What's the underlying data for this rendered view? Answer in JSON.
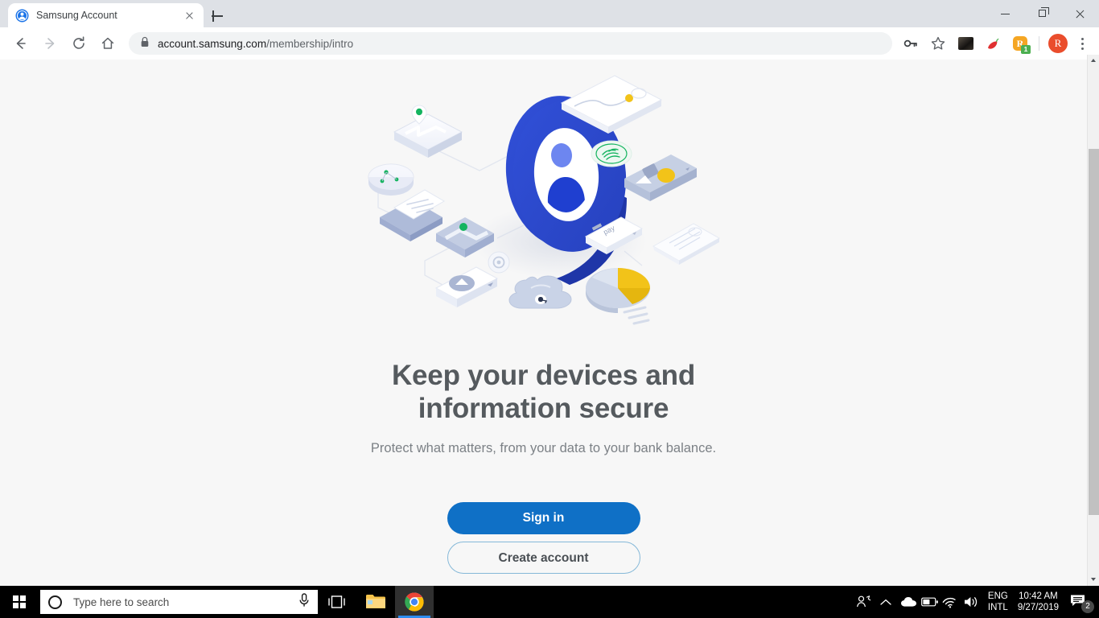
{
  "browser": {
    "tab": {
      "title": "Samsung Account",
      "favicon": "samsung-account-favicon",
      "close_label": "×"
    },
    "newtab_label": "+",
    "window_controls": {
      "minimize": "minimize-icon",
      "restore": "restore-icon",
      "close": "close-icon"
    },
    "nav": {
      "back": "back-arrow-icon",
      "forward": "forward-arrow-icon",
      "reload": "reload-icon",
      "home": "home-icon"
    },
    "omnibox": {
      "lock": "lock-icon",
      "domain": "account.samsung.com",
      "path": "/membership/intro",
      "full_url": "account.samsung.com/membership/intro"
    },
    "toolbar_icons": [
      {
        "name": "password-key-icon",
        "glyph": "key"
      },
      {
        "name": "bookmark-star-icon",
        "glyph": "star"
      },
      {
        "name": "extension-thumbnail-icon",
        "glyph": "photo"
      },
      {
        "name": "extension-pepper-icon",
        "glyph": "pepper"
      },
      {
        "name": "extension-rakuten-icon",
        "glyph": "R",
        "badge": "1",
        "badge_color": "#4caf50"
      }
    ],
    "profile_avatar": "R",
    "menu": "kebab-menu-icon"
  },
  "page": {
    "headline_line1": "Keep your devices and",
    "headline_line2": "information secure",
    "subheadline": "Protect what matters, from your data to your bank balance.",
    "primary_button": "Sign in",
    "secondary_button": "Create account",
    "illustration": "samsung-account-isometric-illustration",
    "colors": {
      "primary_blue": "#0f70c6",
      "illustration_blue": "#2845c8",
      "accent_yellow": "#f2c319",
      "accent_green": "#14b45f",
      "headline_gray": "#555a5e",
      "subheadline_gray": "#7c8186",
      "page_background": "#f7f7f7"
    }
  },
  "taskbar": {
    "start": "windows-start-icon",
    "search_placeholder": "Type here to search",
    "search_circle": "cortana-circle-icon",
    "mic": "microphone-icon",
    "task_view": "task-view-icon",
    "apps": [
      {
        "name": "file-explorer",
        "active": false
      },
      {
        "name": "google-chrome",
        "active": true
      }
    ],
    "tray": [
      {
        "name": "meet-now-people-icon"
      },
      {
        "name": "show-hidden-icons-chevron"
      },
      {
        "name": "onedrive-cloud-icon"
      },
      {
        "name": "battery-icon"
      },
      {
        "name": "wifi-icon"
      },
      {
        "name": "volume-icon"
      }
    ],
    "language_line1": "ENG",
    "language_line2": "INTL",
    "time": "10:42 AM",
    "date": "9/27/2019",
    "notifications": "notification-icon",
    "notification_count": "2"
  }
}
